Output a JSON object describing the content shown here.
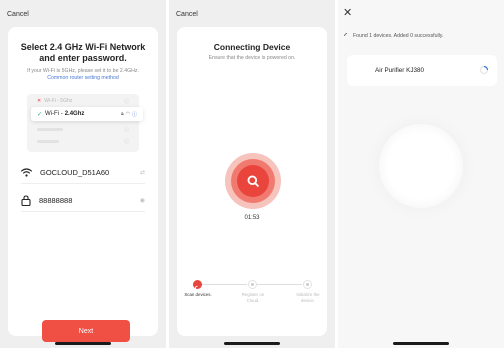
{
  "screen1": {
    "cancel_label": "Cancel",
    "title": "Select 2.4 GHz Wi-Fi Network and enter password.",
    "subtitle": "If your Wi-Fi is 5GHz, please set it to be 2.4GHz.",
    "link": "Common router setting method",
    "illustration": {
      "row_5g": "Wi-Fi - 5Ghz",
      "row_24_prefix": "Wi-Fi -",
      "row_24_name": "2.4Ghz"
    },
    "network_name": "GOCLOUD_D51A60",
    "password": "88888888",
    "next_label": "Next"
  },
  "screen2": {
    "cancel_label": "Cancel",
    "title": "Connecting Device",
    "subtitle": "Ensure that the device is powered on.",
    "timer": "01:53",
    "steps": [
      {
        "label": "Scan devices.",
        "state": "active"
      },
      {
        "label": "Register on Cloud.",
        "state": "pending"
      },
      {
        "label": "Initialize the device.",
        "state": "pending"
      }
    ]
  },
  "screen3": {
    "found_text": "Found 1 devices. Added 0 successfully.",
    "device_name": "Air Purifier KJ380"
  },
  "colors": {
    "accent": "#f04f44",
    "link": "#4a79d4",
    "check": "#1fb36b"
  }
}
